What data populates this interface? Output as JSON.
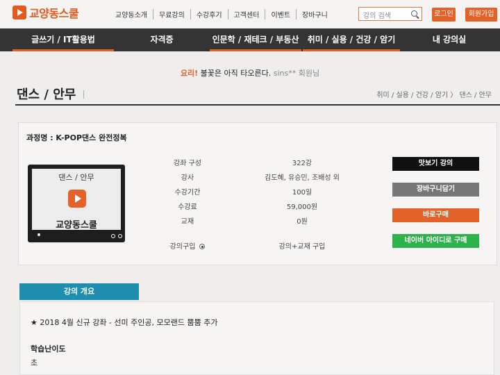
{
  "header": {
    "logo_text": "교양동스쿨",
    "nav": [
      "교양동소개",
      "무료강의",
      "수강후기",
      "고객센터",
      "이벤트",
      "장바구니"
    ],
    "search_placeholder": "강의 검색",
    "login_label": "로그인",
    "signup_label": "회원가입"
  },
  "menu": [
    "글쓰기 / IT활용법",
    "자격증",
    "인문학 / 재테크 / 부동산",
    "취미 / 실용 / 건강 / 암기",
    "내 강의실"
  ],
  "notice": {
    "prefix": "요리!",
    "message": "불꽃은 아직 타오른다.",
    "user": "sins**",
    "suffix": "회원님"
  },
  "page": {
    "title": "댄스 / 안무",
    "breadcrumb": "취미 / 실용 / 건강 / 암기 〉 댄스 / 안무"
  },
  "course": {
    "name_label": "과정명 : K-POP댄스 완전정복",
    "thumb_category": "댄스 / 안무",
    "thumb_logo": "교양동스쿨",
    "info": [
      {
        "label": "강좌 구성",
        "value": "322강"
      },
      {
        "label": "강사",
        "value": "김도혜, 유승민, 조배성 외"
      },
      {
        "label": "수강기간",
        "value": "100일"
      },
      {
        "label": "수강료",
        "value": "59,000원"
      },
      {
        "label": "교재",
        "value": "0원"
      }
    ],
    "purchase_options": [
      "강의구입",
      "강의+교재 구입"
    ],
    "buttons": {
      "preview": "맛보기 강의",
      "cart": "장바구니담기",
      "buy": "바로구매",
      "naver": "네이버 아이디로 구매"
    },
    "button_colors": {
      "preview": "#111111",
      "cart": "#777777",
      "buy": "#e2622a",
      "naver": "#2db34a"
    }
  },
  "overview": {
    "tab_label": "강의 개요",
    "update_text": "★ 2018 4월 신규 강좌 - 선미 주인공, 모모랜드 뿜뿜 추가",
    "level_label": "학습난이도",
    "level_value": "초"
  }
}
